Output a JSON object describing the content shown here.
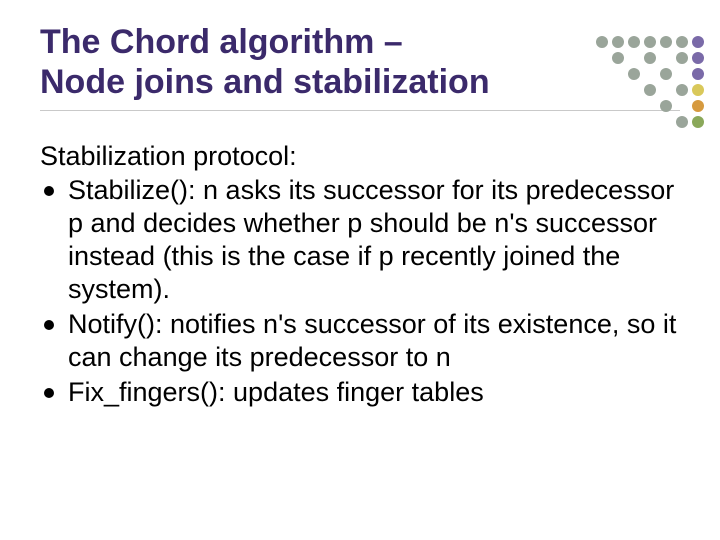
{
  "title_line1": "The Chord algorithm –",
  "title_line2": "Node joins and stabilization",
  "subheading": "Stabilization protocol:",
  "bullets": [
    "Stabilize(): n asks its successor for its predecessor p and decides whether p should be n's successor instead (this is the case if p recently joined the system).",
    "Notify(): notifies n's successor of its existence, so it can change its predecessor to n",
    "Fix_fingers(): updates finger tables"
  ]
}
